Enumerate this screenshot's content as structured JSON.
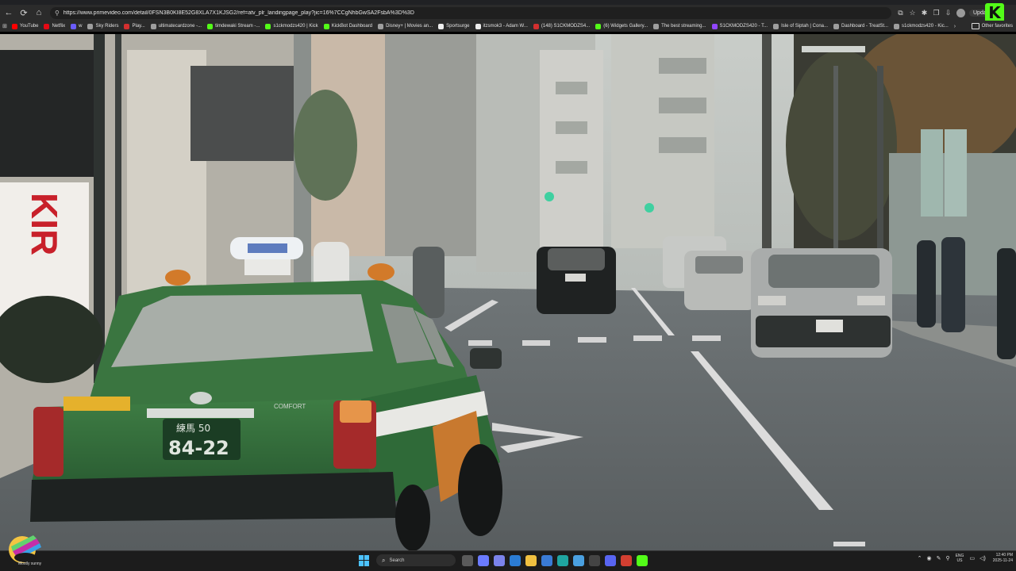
{
  "browser": {
    "url": "https://www.primevideo.com/detail/0FSN3B0KI8E52G8XLA7X1KJSG2/ref=atv_plr_landingpage_play?jic=16%7CCgNhbGwSA2FsbA%3D%3D",
    "update_label": "Updat",
    "other_favorites": "Other favorites",
    "bookmarks": [
      {
        "label": "YouTube",
        "color": "#ff0000"
      },
      {
        "label": "Netflix",
        "color": "#e50914"
      },
      {
        "label": "w",
        "color": "#6a5cff"
      },
      {
        "label": "Sky Riders",
        "color": "#9e9e9e"
      },
      {
        "label": "Play...",
        "color": "#d32f2f"
      },
      {
        "label": "ultimatecardzone -...",
        "color": "#9e9e9e"
      },
      {
        "label": "timdewaki Stream -...",
        "color": "#53fc18"
      },
      {
        "label": "s1ckmodzs420 | Kick",
        "color": "#53fc18"
      },
      {
        "label": "KickBot Dashboard",
        "color": "#53fc18"
      },
      {
        "label": "Disney+ | Movies an...",
        "color": "#9e9e9e"
      },
      {
        "label": "Sportsurge",
        "color": "#eeeeee"
      },
      {
        "label": "itzsmok3 - Adam W...",
        "color": "#eeeeee"
      },
      {
        "label": "(148) S1CKMODZS4...",
        "color": "#d32f2f"
      },
      {
        "label": "(6) Widgets Gallery...",
        "color": "#53fc18"
      },
      {
        "label": "The best streaming...",
        "color": "#9e9e9e"
      },
      {
        "label": "S1CKMODZS420 - T...",
        "color": "#9146ff"
      },
      {
        "label": "Isle of Siptah | Cona...",
        "color": "#9e9e9e"
      },
      {
        "label": "Dashboard - TreatSt...",
        "color": "#9e9e9e"
      },
      {
        "label": "s1ckmodzs420 - Kic...",
        "color": "#9e9e9e"
      }
    ]
  },
  "video": {
    "sign_text": "KIR",
    "taxi_plate_top": "練馬 50",
    "taxi_plate_number": "84-22",
    "taxi_model_label": "COMFORT"
  },
  "taskbar": {
    "weather_text": "Mostly sunny",
    "search_placeholder": "Search",
    "language_line1": "ENG",
    "language_line2": "US",
    "time": "12:40 PM",
    "date": "2025-11-24",
    "apps": [
      {
        "name": "task-view",
        "color": "#5a5a5a"
      },
      {
        "name": "copilot",
        "color": "#6b7bff"
      },
      {
        "name": "teams",
        "color": "#7b83eb"
      },
      {
        "name": "mail",
        "color": "#2b7cd3"
      },
      {
        "name": "file-explorer",
        "color": "#f0c040"
      },
      {
        "name": "store",
        "color": "#3a7bd5"
      },
      {
        "name": "edge",
        "color": "#1fa5a0"
      },
      {
        "name": "photos",
        "color": "#4aa0e0"
      },
      {
        "name": "steam",
        "color": "#444444"
      },
      {
        "name": "discord",
        "color": "#5865f2"
      },
      {
        "name": "chrome",
        "color": "#d23f31"
      },
      {
        "name": "kick",
        "color": "#53fc18"
      }
    ]
  }
}
